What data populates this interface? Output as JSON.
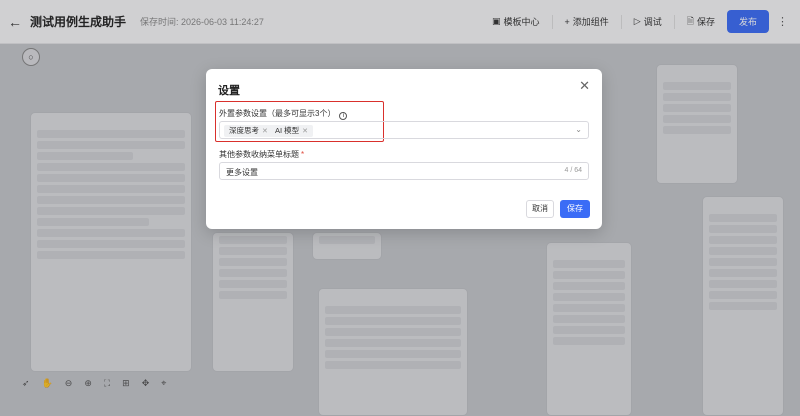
{
  "header": {
    "title": "测试用例生成助手",
    "save_time": "保存时间: 2026-06-03 11:24:27",
    "actions": {
      "template_center": "模板中心",
      "add_component": "添加组件",
      "debug": "调试",
      "save": "保存",
      "publish": "发布"
    }
  },
  "dialog": {
    "title": "设置",
    "external_params": {
      "label": "外置参数设置（最多可显示3个）",
      "tags": [
        "深度思考",
        "AI 模型"
      ]
    },
    "other_params": {
      "label": "其他参数收纳菜单标题",
      "value": "更多设置",
      "counter": "4 / 64"
    },
    "cancel_label": "取消",
    "save_label": "保存"
  },
  "colors": {
    "accent": "#3b6cf6",
    "highlight_border": "#d9302c"
  }
}
